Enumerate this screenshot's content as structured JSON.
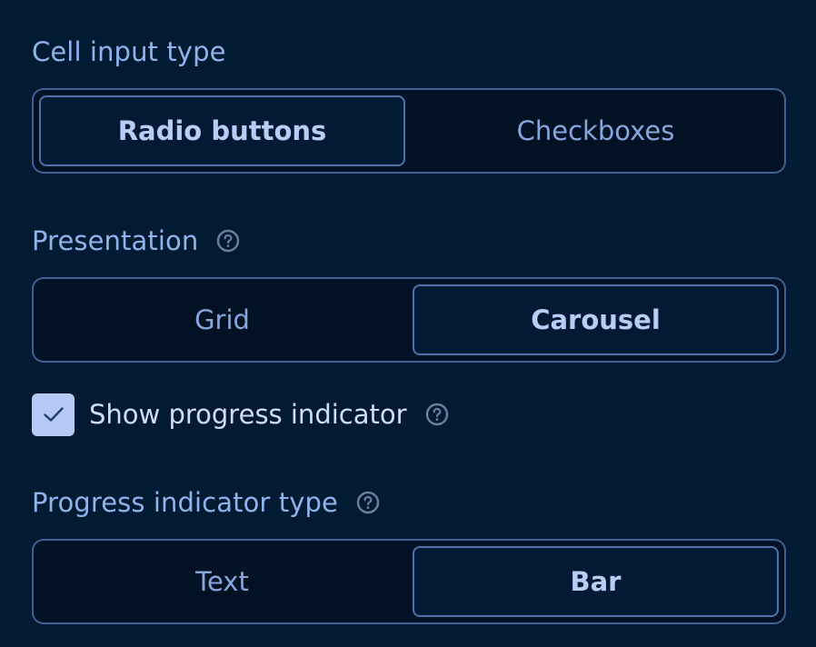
{
  "cell_input_type": {
    "label": "Cell input type",
    "options": [
      "Radio buttons",
      "Checkboxes"
    ],
    "selected": "Radio buttons"
  },
  "presentation": {
    "label": "Presentation",
    "options": [
      "Grid",
      "Carousel"
    ],
    "selected": "Carousel",
    "help_icon": "question-circle-icon"
  },
  "show_progress": {
    "label": "Show progress indicator",
    "checked": true,
    "help_icon": "question-circle-icon"
  },
  "progress_type": {
    "label": "Progress indicator type",
    "options": [
      "Text",
      "Bar"
    ],
    "selected": "Bar",
    "help_icon": "question-circle-icon"
  },
  "colors": {
    "background": "#031a33",
    "accent": "#b6c8f3",
    "border": "#3e5f94"
  }
}
